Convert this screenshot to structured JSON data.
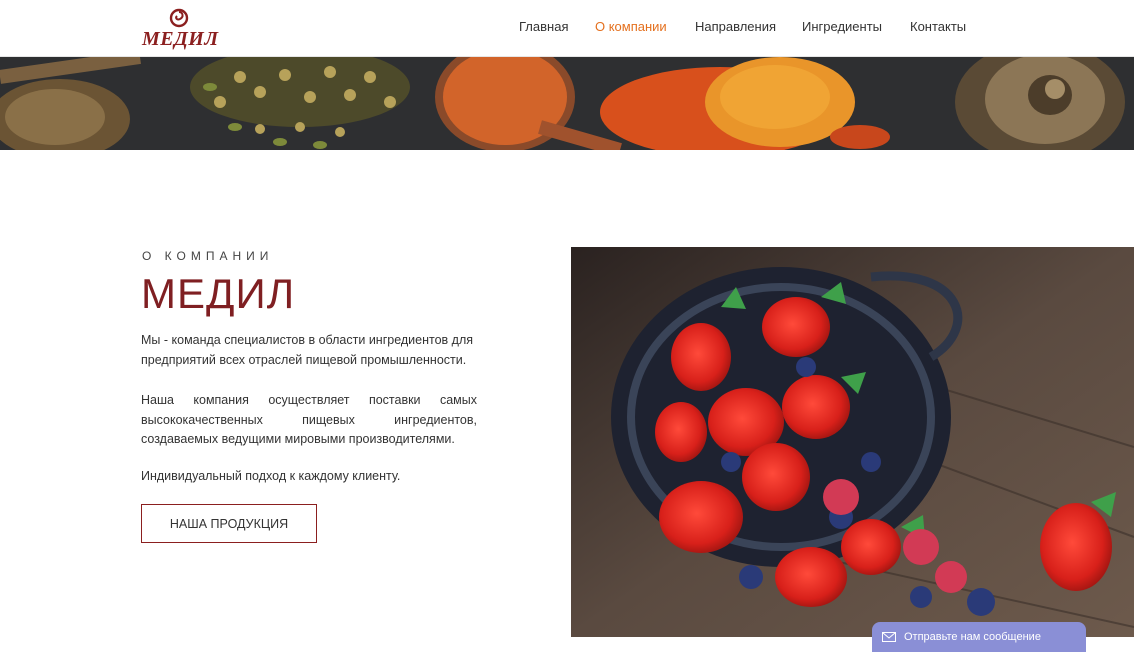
{
  "header": {
    "logo_text": "МЕДИЛ",
    "nav": [
      {
        "label": "Главная",
        "active": false
      },
      {
        "label": "О компании",
        "active": true
      },
      {
        "label": "Направления",
        "active": false
      },
      {
        "label": "Ингредиенты",
        "active": false
      },
      {
        "label": "Контакты",
        "active": false
      }
    ]
  },
  "about": {
    "eyebrow": "О КОМПАНИИ",
    "title": "МЕДИЛ",
    "paragraph1": "Мы - команда специалистов в области ингредиентов для предприятий всех отраслей пищевой промышленности.",
    "paragraph2": "Наша компания осуществляет поставки самых высококачественных пищевых ингредиентов, создаваемых ведущими мировыми производителями.",
    "paragraph3": "Индивидуальный подход к каждому клиенту.",
    "button_label": "НАША ПРОДУКЦИЯ"
  },
  "chat_widget": {
    "label": "Отправьте нам сообщение",
    "icon": "envelope-icon"
  },
  "colors": {
    "brand": "#7f1f22",
    "accent": "#e4701e",
    "chat": "#8a8fd6"
  }
}
